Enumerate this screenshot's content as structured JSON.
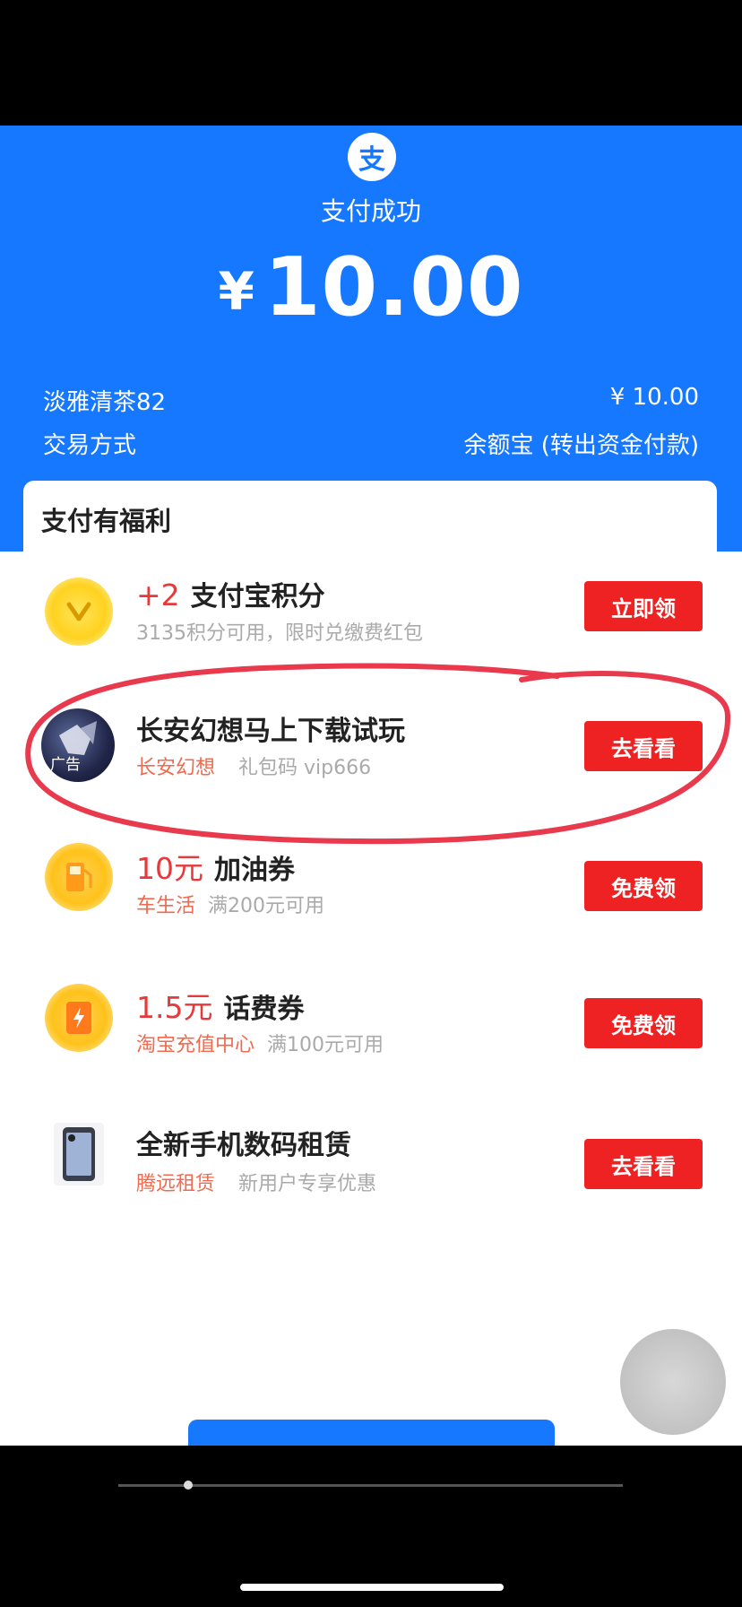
{
  "header": {
    "logo_char": "支",
    "status": "支付成功",
    "currency": "¥",
    "amount": "10.00",
    "merchant": "淡雅清茶82",
    "merchant_amount": "¥ 10.00",
    "method_label": "交易方式",
    "method_value": "余额宝 (转出资金付款)"
  },
  "benefits": {
    "title": "支付有福利",
    "items": [
      {
        "highlight": "+2",
        "title": "支付宝积分",
        "tag": "",
        "sub": "3135积分可用，限时兑缴费红包",
        "button": "立即领",
        "icon": "points-coin-icon"
      },
      {
        "highlight": "",
        "title": "长安幻想马上下载试玩",
        "tag": "长安幻想",
        "sub": "礼包码    vip666",
        "button": "去看看",
        "icon": "game-ad-icon",
        "ad_label": "广告"
      },
      {
        "highlight": "10元",
        "title": "加油券",
        "tag": "车生活",
        "sub": "满200元可用",
        "button": "免费领",
        "icon": "fuel-pump-icon"
      },
      {
        "highlight": "1.5元",
        "title": "话费券",
        "tag": "淘宝充值中心",
        "sub": "满100元可用",
        "button": "免费领",
        "icon": "phone-bill-icon"
      },
      {
        "highlight": "",
        "title": "全新手机数码租赁",
        "tag": "腾远租赁",
        "sub": "新用户专享优惠",
        "button": "去看看",
        "icon": "phone-device-icon"
      }
    ]
  },
  "colors": {
    "brand": "#1677ff",
    "button": "#ee2222",
    "annotation": "#e8394d"
  }
}
